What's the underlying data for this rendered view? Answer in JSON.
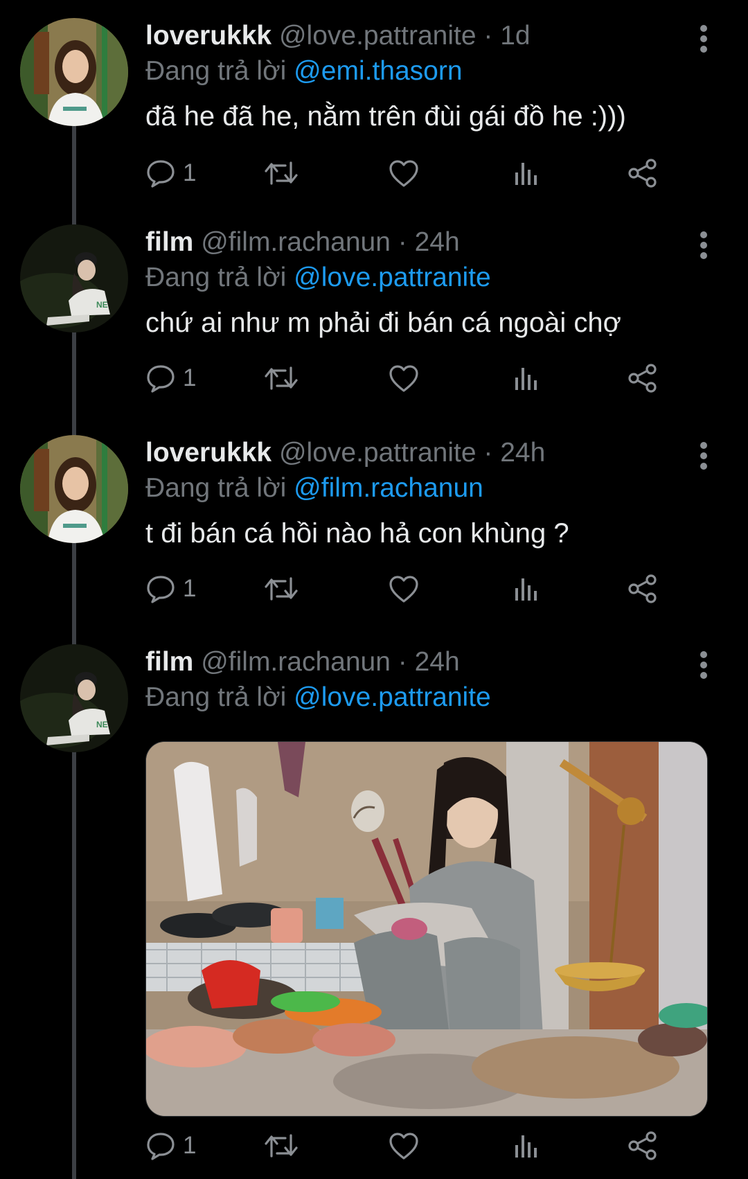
{
  "thread": [
    {
      "name": "loverukkk",
      "handle": "@love.pattranite",
      "separator": "·",
      "time": "1d",
      "replying_prefix": "Đang trả lời",
      "replying_to": "@emi.thasorn",
      "text": "đã he đã he, nằm trên đùi gái đồ he :)))",
      "reply_count": "1"
    },
    {
      "name": "film",
      "handle": "@film.rachanun",
      "separator": "·",
      "time": "24h",
      "replying_prefix": "Đang trả lời",
      "replying_to": "@love.pattranite",
      "text": "chứ ai như m phải đi bán cá ngoài chợ",
      "reply_count": "1"
    },
    {
      "name": "loverukkk",
      "handle": "@love.pattranite",
      "separator": "·",
      "time": "24h",
      "replying_prefix": "Đang trả lời",
      "replying_to": "@film.rachanun",
      "text": "t đi bán cá hồi nào hả con khùng ?",
      "reply_count": "1"
    },
    {
      "name": "film",
      "handle": "@film.rachanun",
      "separator": "·",
      "time": "24h",
      "replying_prefix": "Đang trả lời",
      "replying_to": "@love.pattranite",
      "text": "",
      "reply_count": "1"
    }
  ],
  "icons": {
    "reply": "speech-bubble-icon",
    "retweet": "retweet-arrows-icon",
    "like": "heart-icon",
    "views": "bar-chart-icon",
    "share": "share-nodes-icon",
    "more": "vertical-ellipsis-icon"
  },
  "colors": {
    "background": "#000000",
    "text": "#e7e9ea",
    "secondary": "#71767b",
    "mention": "#1d9bf0",
    "thread_line": "#3c3f44"
  }
}
